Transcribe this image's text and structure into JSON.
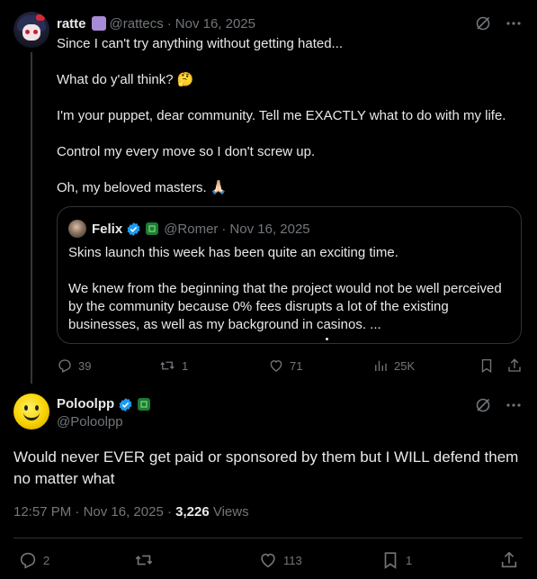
{
  "top_tweet": {
    "name": "ratte",
    "handle": "@rattecs",
    "date": "Nov 16, 2025",
    "paragraphs": [
      "Since I can't try anything without getting hated...",
      "What do y'all think? 🤔",
      "I'm your puppet, dear community. Tell me EXACTLY what to do with my life.",
      "Control my every move so I don't screw up.",
      "Oh, my beloved masters. 🙏🏻"
    ],
    "quote": {
      "name": "Felix",
      "handle": "@Romer",
      "date": "Nov 16, 2025",
      "paragraphs": [
        "Skins launch this week has been quite an exciting time.",
        "We knew from the beginning that the project would not be well perceived by the community because 0% fees disrupts a lot of the existing businesses, as well as my background in casinos.  ..."
      ]
    },
    "actions": {
      "replies": "39",
      "reposts": "1",
      "likes": "71",
      "views": "25K"
    }
  },
  "reply_tweet": {
    "name": "Poloolpp",
    "handle": "@Poloolpp",
    "text": "Would never EVER get paid or sponsored by them but I WILL defend them no matter what",
    "time": "12:57 PM",
    "date": "Nov 16, 2025",
    "views_count": "3,226",
    "views_label": "Views",
    "actions": {
      "replies": "2",
      "likes": "113",
      "bookmarks": "1"
    }
  },
  "colors": {
    "background": "#000000",
    "text": "#e7e9ea",
    "muted": "#71767b",
    "verified": "#1d9bf0",
    "border": "#2f3336"
  },
  "icons": [
    "grok-icon",
    "more-icon",
    "verified-icon",
    "reply-icon",
    "repost-icon",
    "like-icon",
    "views-icon",
    "bookmark-icon",
    "share-icon"
  ]
}
